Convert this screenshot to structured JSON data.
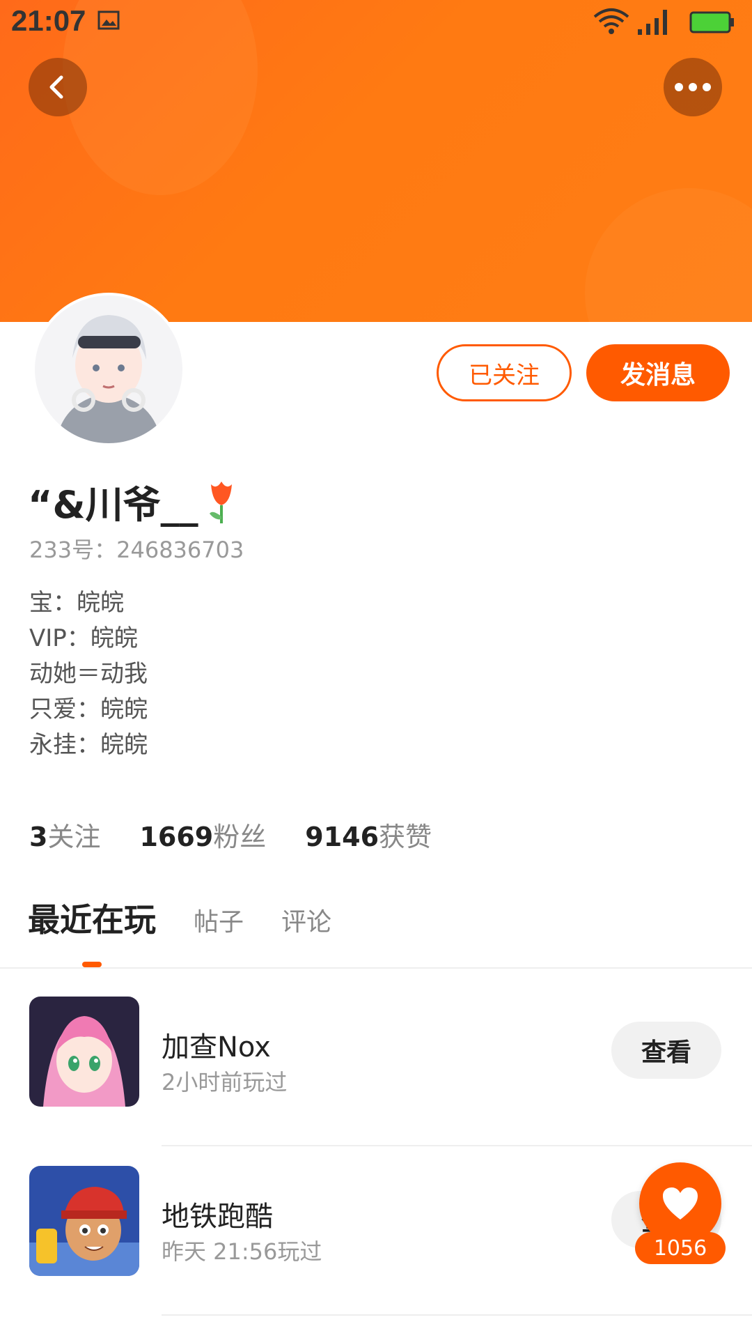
{
  "status_bar": {
    "time": "21:07",
    "icons": [
      "image-icon",
      "wifi-icon",
      "signal-icon",
      "battery-icon"
    ]
  },
  "header": {
    "accent_color": "#ff5a00",
    "back_icon": "chevron-left-icon",
    "more_icon": "more-dots-icon"
  },
  "profile": {
    "name": "“&川爷__",
    "name_emoji": "tulip-icon",
    "id_label": "233号",
    "id_separator": "：",
    "id_value": "246836703",
    "bio_lines": [
      "宝：皖皖",
      "VIP：皖皖",
      "动她＝动我",
      "只爱：皖皖",
      "永挂：皖皖"
    ]
  },
  "actions": {
    "follow_label": "已关注",
    "message_label": "发消息"
  },
  "stats": [
    {
      "num": "3",
      "label": "关注"
    },
    {
      "num": "1669",
      "label": "粉丝"
    },
    {
      "num": "9146",
      "label": "获赞"
    }
  ],
  "tabs": [
    {
      "label": "最近在玩",
      "active": true
    },
    {
      "label": "帖子",
      "active": false
    },
    {
      "label": "评论",
      "active": false
    }
  ],
  "games": [
    {
      "title": "加查Nox",
      "subtitle": "2小时前玩过",
      "button": "查看",
      "icon": "gacha-nox-game-icon"
    },
    {
      "title": "地铁跑酷",
      "subtitle": "昨天 21:56玩过",
      "button": "查看",
      "icon": "subway-surfers-game-icon"
    }
  ],
  "like": {
    "icon": "heart-icon",
    "count": "1056"
  }
}
